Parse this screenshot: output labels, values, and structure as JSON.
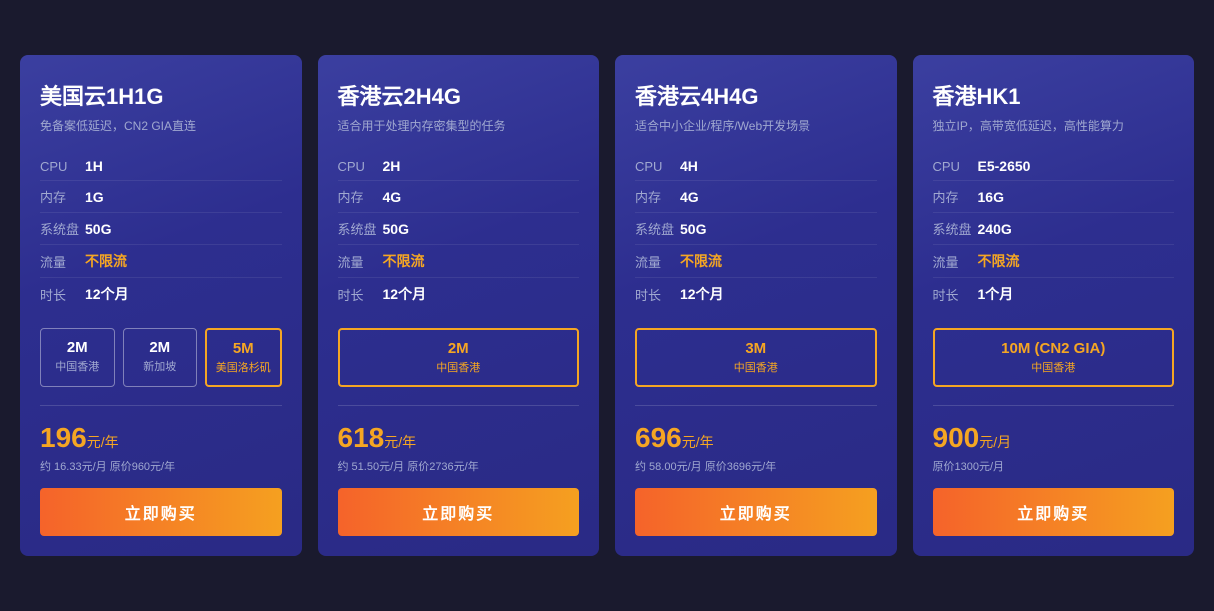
{
  "cards": [
    {
      "id": "card-1",
      "title": "美国云1H1G",
      "subtitle": "免备案低延迟，CN2 GIA直连",
      "specs": [
        {
          "label": "CPU",
          "value": "1H",
          "unlimited": false
        },
        {
          "label": "内存",
          "value": "1G",
          "unlimited": false
        },
        {
          "label": "系统盘",
          "value": "50G",
          "unlimited": false
        },
        {
          "label": "流量",
          "value": "不限流",
          "unlimited": true
        },
        {
          "label": "时长",
          "value": "12个月",
          "unlimited": false
        }
      ],
      "bandwidths": [
        {
          "value": "2M",
          "location": "中国香港",
          "active": false
        },
        {
          "value": "2M",
          "location": "新加坡",
          "active": false
        },
        {
          "value": "5M",
          "location": "美国洛杉矶",
          "active": true
        }
      ],
      "price_main": "196",
      "price_unit": "元/年",
      "price_detail": "约 16.33元/月  原价960元/年",
      "buy_label": "立即购买"
    },
    {
      "id": "card-2",
      "title": "香港云2H4G",
      "subtitle": "适合用于处理内存密集型的任务",
      "specs": [
        {
          "label": "CPU",
          "value": "2H",
          "unlimited": false
        },
        {
          "label": "内存",
          "value": "4G",
          "unlimited": false
        },
        {
          "label": "系统盘",
          "value": "50G",
          "unlimited": false
        },
        {
          "label": "流量",
          "value": "不限流",
          "unlimited": true
        },
        {
          "label": "时长",
          "value": "12个月",
          "unlimited": false
        }
      ],
      "bandwidths": [
        {
          "value": "2M",
          "location": "中国香港",
          "active": true
        }
      ],
      "price_main": "618",
      "price_unit": "元/年",
      "price_detail": "约 51.50元/月  原价2736元/年",
      "buy_label": "立即购买"
    },
    {
      "id": "card-3",
      "title": "香港云4H4G",
      "subtitle": "适合中小企业/程序/Web开发场景",
      "specs": [
        {
          "label": "CPU",
          "value": "4H",
          "unlimited": false
        },
        {
          "label": "内存",
          "value": "4G",
          "unlimited": false
        },
        {
          "label": "系统盘",
          "value": "50G",
          "unlimited": false
        },
        {
          "label": "流量",
          "value": "不限流",
          "unlimited": true
        },
        {
          "label": "时长",
          "value": "12个月",
          "unlimited": false
        }
      ],
      "bandwidths": [
        {
          "value": "3M",
          "location": "中国香港",
          "active": true
        }
      ],
      "price_main": "696",
      "price_unit": "元/年",
      "price_detail": "约 58.00元/月  原价3696元/年",
      "buy_label": "立即购买"
    },
    {
      "id": "card-4",
      "title": "香港HK1",
      "subtitle": "独立IP，高带宽低延迟，高性能算力",
      "specs": [
        {
          "label": "CPU",
          "value": "E5-2650",
          "unlimited": false
        },
        {
          "label": "内存",
          "value": "16G",
          "unlimited": false
        },
        {
          "label": "系统盘",
          "value": "240G",
          "unlimited": false
        },
        {
          "label": "流量",
          "value": "不限流",
          "unlimited": true
        },
        {
          "label": "时长",
          "value": "1个月",
          "unlimited": false
        }
      ],
      "bandwidths": [
        {
          "value": "10M (CN2 GIA)",
          "location": "中国香港",
          "active": true
        }
      ],
      "price_main": "900",
      "price_unit": "元/月",
      "price_detail": "原价1300元/月",
      "buy_label": "立即购买"
    }
  ]
}
